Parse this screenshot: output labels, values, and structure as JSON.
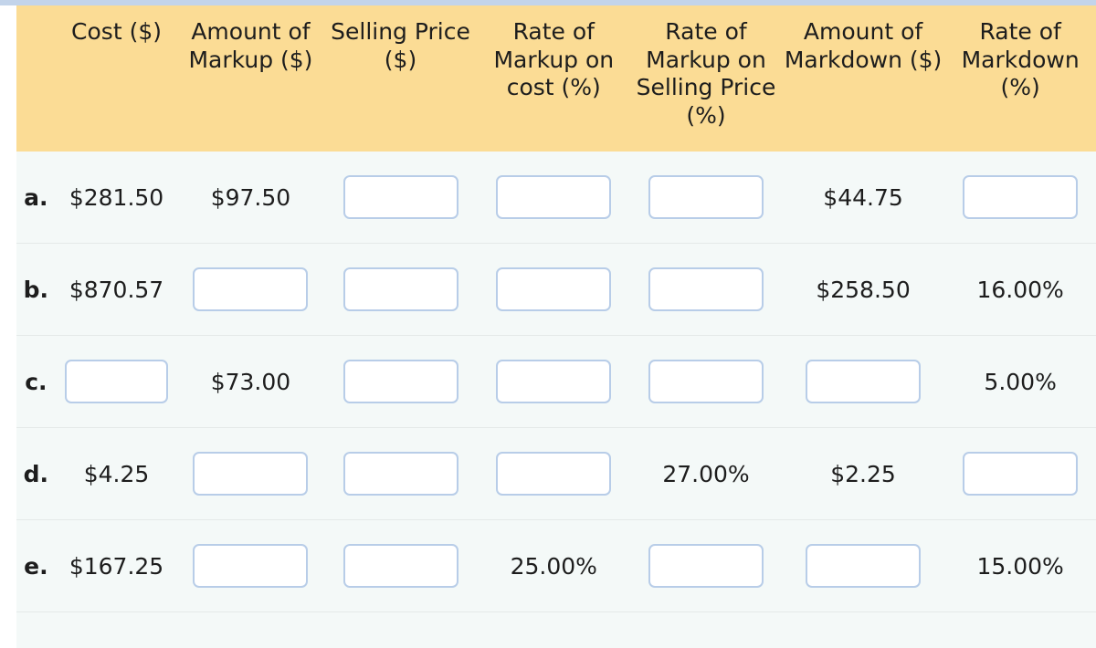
{
  "theme": {
    "header_background": "#fbdc95",
    "body_background": "#f4f9f8",
    "top_rule_color": "#c3d4ea",
    "input_border_color": "#b8cde8",
    "row_divider_color": "#e4e9e8",
    "text_color": "#1d1d1d"
  },
  "table": {
    "headers": [
      {
        "id": "label",
        "label": ""
      },
      {
        "id": "cost",
        "label": "Cost ($)"
      },
      {
        "id": "markup_amount",
        "label": "Amount of Markup ($)"
      },
      {
        "id": "selling_price",
        "label": "Selling Price ($)"
      },
      {
        "id": "rate_markup_cost",
        "label": "Rate of Markup on cost (%)"
      },
      {
        "id": "rate_markup_selling",
        "label": "Rate of Markup on Selling Price (%)"
      },
      {
        "id": "markdown_amount",
        "label": "Amount of Markdown ($)"
      },
      {
        "id": "rate_markdown",
        "label": "Rate of Markdown (%)"
      }
    ],
    "rows": [
      {
        "label": "a.",
        "cells": [
          {
            "column": "cost",
            "type": "value",
            "text": "$281.50"
          },
          {
            "column": "markup_amount",
            "type": "value",
            "text": "$97.50"
          },
          {
            "column": "selling_price",
            "type": "input",
            "value": "",
            "placeholder": ""
          },
          {
            "column": "rate_markup_cost",
            "type": "input",
            "value": "",
            "placeholder": ""
          },
          {
            "column": "rate_markup_selling",
            "type": "input",
            "value": "",
            "placeholder": ""
          },
          {
            "column": "markdown_amount",
            "type": "value",
            "text": "$44.75"
          },
          {
            "column": "rate_markdown",
            "type": "input",
            "value": "",
            "placeholder": ""
          }
        ]
      },
      {
        "label": "b.",
        "cells": [
          {
            "column": "cost",
            "type": "value",
            "text": "$870.57"
          },
          {
            "column": "markup_amount",
            "type": "input",
            "value": "",
            "placeholder": ""
          },
          {
            "column": "selling_price",
            "type": "input",
            "value": "",
            "placeholder": ""
          },
          {
            "column": "rate_markup_cost",
            "type": "input",
            "value": "",
            "placeholder": ""
          },
          {
            "column": "rate_markup_selling",
            "type": "input",
            "value": "",
            "placeholder": ""
          },
          {
            "column": "markdown_amount",
            "type": "value",
            "text": "$258.50"
          },
          {
            "column": "rate_markdown",
            "type": "value",
            "text": "16.00%"
          }
        ]
      },
      {
        "label": "c.",
        "cells": [
          {
            "column": "cost",
            "type": "input",
            "value": "",
            "placeholder": ""
          },
          {
            "column": "markup_amount",
            "type": "value",
            "text": "$73.00"
          },
          {
            "column": "selling_price",
            "type": "input",
            "value": "",
            "placeholder": ""
          },
          {
            "column": "rate_markup_cost",
            "type": "input",
            "value": "",
            "placeholder": ""
          },
          {
            "column": "rate_markup_selling",
            "type": "input",
            "value": "",
            "placeholder": ""
          },
          {
            "column": "markdown_amount",
            "type": "input",
            "value": "",
            "placeholder": ""
          },
          {
            "column": "rate_markdown",
            "type": "value",
            "text": "5.00%"
          }
        ]
      },
      {
        "label": "d.",
        "cells": [
          {
            "column": "cost",
            "type": "value",
            "text": "$4.25"
          },
          {
            "column": "markup_amount",
            "type": "input",
            "value": "",
            "placeholder": ""
          },
          {
            "column": "selling_price",
            "type": "input",
            "value": "",
            "placeholder": ""
          },
          {
            "column": "rate_markup_cost",
            "type": "input",
            "value": "",
            "placeholder": ""
          },
          {
            "column": "rate_markup_selling",
            "type": "value",
            "text": "27.00%"
          },
          {
            "column": "markdown_amount",
            "type": "value",
            "text": "$2.25"
          },
          {
            "column": "rate_markdown",
            "type": "input",
            "value": "",
            "placeholder": ""
          }
        ]
      },
      {
        "label": "e.",
        "cells": [
          {
            "column": "cost",
            "type": "value",
            "text": "$167.25"
          },
          {
            "column": "markup_amount",
            "type": "input",
            "value": "",
            "placeholder": ""
          },
          {
            "column": "selling_price",
            "type": "input",
            "value": "",
            "placeholder": ""
          },
          {
            "column": "rate_markup_cost",
            "type": "value",
            "text": "25.00%"
          },
          {
            "column": "rate_markup_selling",
            "type": "input",
            "value": "",
            "placeholder": ""
          },
          {
            "column": "markdown_amount",
            "type": "input",
            "value": "",
            "placeholder": ""
          },
          {
            "column": "rate_markdown",
            "type": "value",
            "text": "15.00%"
          }
        ]
      }
    ]
  }
}
